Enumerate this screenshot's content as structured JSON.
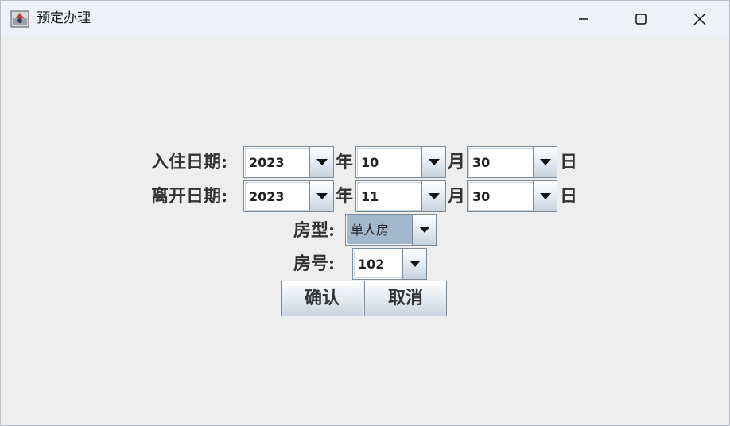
{
  "window": {
    "title": "预定办理"
  },
  "checkin": {
    "label": "入住日期:",
    "year": "2023",
    "year_unit": "年",
    "month": "10",
    "month_unit": "月",
    "day": "30",
    "day_unit": "日"
  },
  "checkout": {
    "label": "离开日期:",
    "year": "2023",
    "year_unit": "年",
    "month": "11",
    "month_unit": "月",
    "day": "30",
    "day_unit": "日"
  },
  "room_type": {
    "label": "房型:",
    "value": "单人房"
  },
  "room_number": {
    "label": "房号:",
    "value": "102"
  },
  "buttons": {
    "confirm": "确认",
    "cancel": "取消"
  }
}
